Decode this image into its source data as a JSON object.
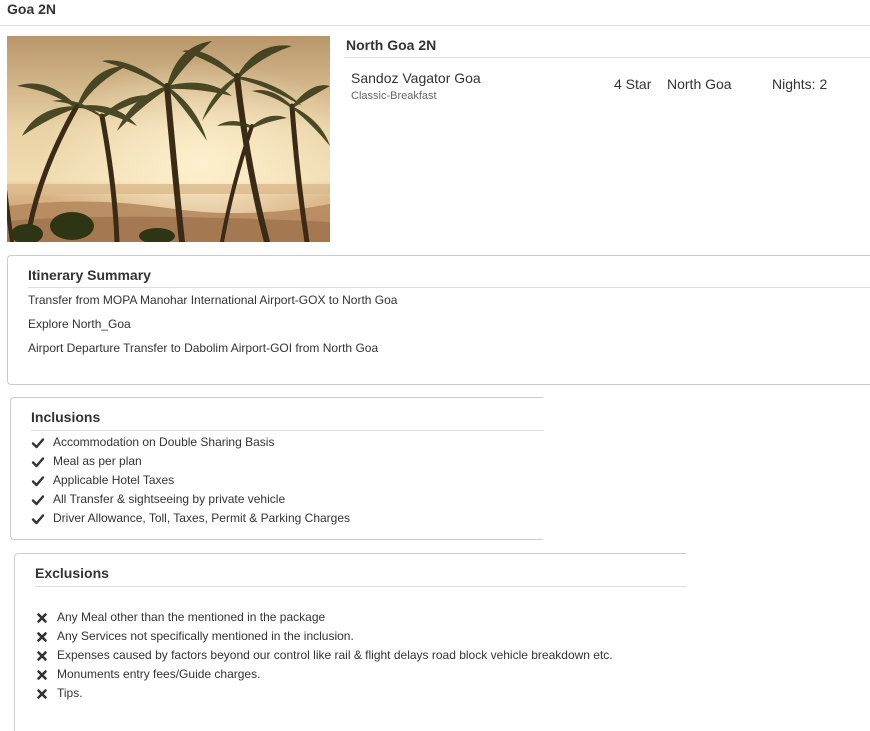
{
  "package": {
    "title": "Goa 2N"
  },
  "hotel": {
    "heading": "North Goa 2N",
    "name": "Sandoz Vagator Goa",
    "meal_plan": "Classic-Breakfast",
    "rating": "4 Star",
    "location": "North Goa",
    "nights": "Nights: 2",
    "image_alt": "Palm trees on a beach at sunset"
  },
  "itinerary": {
    "title": "Itinerary Summary",
    "items": [
      "Transfer from MOPA Manohar International Airport-GOX to North Goa",
      "Explore North_Goa",
      "Airport Departure Transfer to Dabolim Airport-GOI from North Goa"
    ]
  },
  "inclusions": {
    "title": "Inclusions",
    "icon": "check-icon",
    "items": [
      "Accommodation on Double Sharing Basis",
      "Meal as per plan",
      "Applicable Hotel Taxes",
      "All Transfer & sightseeing by private vehicle",
      "Driver Allowance, Toll, Taxes, Permit & Parking Charges"
    ]
  },
  "exclusions": {
    "title": "Exclusions",
    "icon": "cross-icon",
    "items": [
      "Any Meal other than the mentioned in the package",
      "Any Services not specifically mentioned in the inclusion.",
      "Expenses caused by factors beyond our control like rail & flight delays road block vehicle breakdown etc.",
      "Monuments entry fees/Guide charges.",
      "Tips."
    ]
  },
  "colors": {
    "text": "#333333",
    "muted": "#666666",
    "border": "#cccccc",
    "rule": "#dddddd"
  }
}
